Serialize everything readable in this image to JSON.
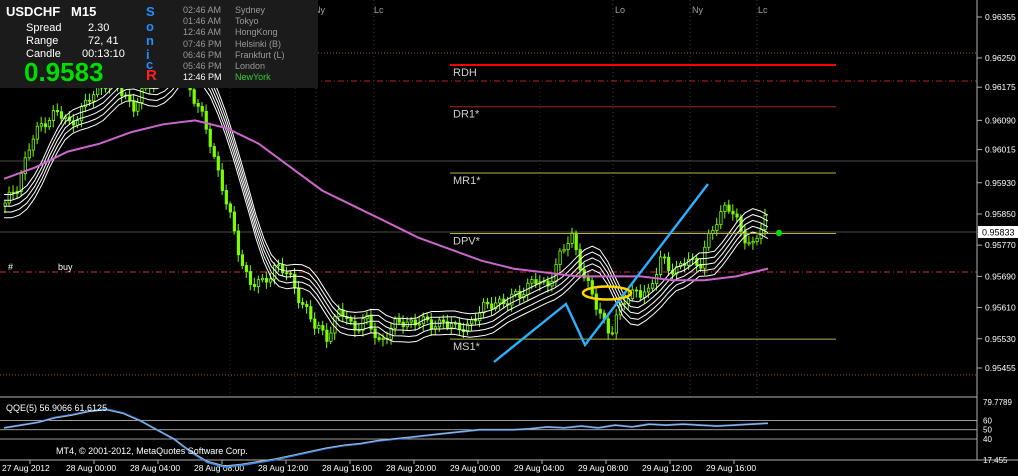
{
  "info": {
    "symbol": "USDCHF",
    "timeframe": "M15",
    "spread_label": "Spread",
    "spread_value": "2.30",
    "range_label": "Range",
    "range_value": "72, 41",
    "candle_label": "Candle",
    "candle_value": "00:13:10",
    "price": "0.9583",
    "sonic_letters": [
      "S",
      "o",
      "n",
      "i",
      "c",
      "R"
    ],
    "sessions": [
      {
        "time": "02:46 AM",
        "name": "Sydney"
      },
      {
        "time": "01:46 AM",
        "name": "Tokyo"
      },
      {
        "time": "12:46 AM",
        "name": "HongKong"
      },
      {
        "time": "07:46 PM",
        "name": "Helsinki (B)"
      },
      {
        "time": "06:46 PM",
        "name": "Frankfurt (L)"
      },
      {
        "time": "05:46 PM",
        "name": "London"
      },
      {
        "time": "12:46 PM",
        "name": "NewYork"
      }
    ]
  },
  "colors": {
    "background": "#000000",
    "candle": "#7CFC00",
    "ma_purple": "#cc66cc",
    "band": "#ffffff",
    "cyan": "#1e90ff",
    "rdh": "#ff0000",
    "ellipse": "#ffd700",
    "qqe": "#3a87e8"
  },
  "session_markers": [
    "Ny",
    "Lc",
    "Lo",
    "Ny",
    "Lc"
  ],
  "pivot_levels": [
    {
      "label": "RDH",
      "value": 0.96232
    },
    {
      "label": "DR1*",
      "value": 0.96125
    },
    {
      "label": "MR1*",
      "value": 0.95955
    },
    {
      "label": "DPV*",
      "value": 0.958
    },
    {
      "label": "MS1*",
      "value": 0.95529
    }
  ],
  "order_label": "#",
  "order_side": "buy",
  "current_price_tag": "0.95833",
  "indicator": {
    "label": "QQE(5) 56.9066 61.6125",
    "scale": [
      "79.7789",
      "60",
      "50",
      "40",
      "17.455"
    ]
  },
  "copyright": "MT4, © 2001-2012, MetaQuotes Software Corp.",
  "chart_data": {
    "type": "candlestick",
    "symbol": "USDCHF",
    "timeframe": "M15",
    "price_axis_ticks": [
      0.96355,
      0.9625,
      0.96175,
      0.9609,
      0.96015,
      0.9593,
      0.9585,
      0.9577,
      0.9569,
      0.9561,
      0.9553,
      0.95455
    ],
    "price_axis_labels": [
      "0.96355",
      "0.96250",
      "0.96175",
      "0.96090",
      "0.96015",
      "0.95930",
      "0.95850",
      "0.95770",
      "0.95690",
      "0.95610",
      "0.95530",
      "0.95455"
    ],
    "time_axis_labels": [
      "27 Aug 2012",
      "28 Aug 00:00",
      "28 Aug 04:00",
      "28 Aug 08:00",
      "28 Aug 12:00",
      "28 Aug 16:00",
      "28 Aug 20:00",
      "29 Aug 00:00",
      "29 Aug 04:00",
      "29 Aug 08:00",
      "29 Aug 12:00",
      "29 Aug 16:00"
    ],
    "close_path": [
      0.9587,
      0.9593,
      0.9603,
      0.9609,
      0.9611,
      0.9608,
      0.9612,
      0.9616,
      0.962,
      0.9616,
      0.9613,
      0.9617,
      0.9622,
      0.9626,
      0.962,
      0.9612,
      0.9603,
      0.959,
      0.9577,
      0.9567,
      0.9567,
      0.9572,
      0.9569,
      0.9563,
      0.9556,
      0.9554,
      0.956,
      0.9556,
      0.9558,
      0.9552,
      0.9556,
      0.9557,
      0.9558,
      0.9556,
      0.9558,
      0.9555,
      0.9557,
      0.956,
      0.9563,
      0.9562,
      0.9565,
      0.9568,
      0.9566,
      0.9574,
      0.9579,
      0.9569,
      0.956,
      0.9555,
      0.9562,
      0.9566,
      0.9564,
      0.9575,
      0.9569,
      0.9574,
      0.9572,
      0.9582,
      0.9588,
      0.9581,
      0.9577,
      0.9583
    ],
    "ma": [
      0.9594,
      0.9597,
      0.9601,
      0.9603,
      0.9606,
      0.9608,
      0.9609,
      0.9607,
      0.9603,
      0.9597,
      0.9591,
      0.9587,
      0.9583,
      0.9579,
      0.9576,
      0.9573,
      0.9571,
      0.957,
      0.9569,
      0.9569,
      0.9569,
      0.9568,
      0.9568,
      0.9569,
      0.9571
    ],
    "qqe": [
      52,
      55,
      58,
      63,
      66,
      70,
      72,
      68,
      60,
      50,
      40,
      26,
      15,
      10,
      12,
      15,
      18,
      22,
      26,
      30,
      33,
      35,
      38,
      40,
      42,
      44,
      46,
      48,
      50,
      50,
      50,
      51,
      53,
      52,
      54,
      52,
      55,
      53,
      56,
      55,
      56,
      55,
      54,
      55,
      56,
      57
    ]
  }
}
